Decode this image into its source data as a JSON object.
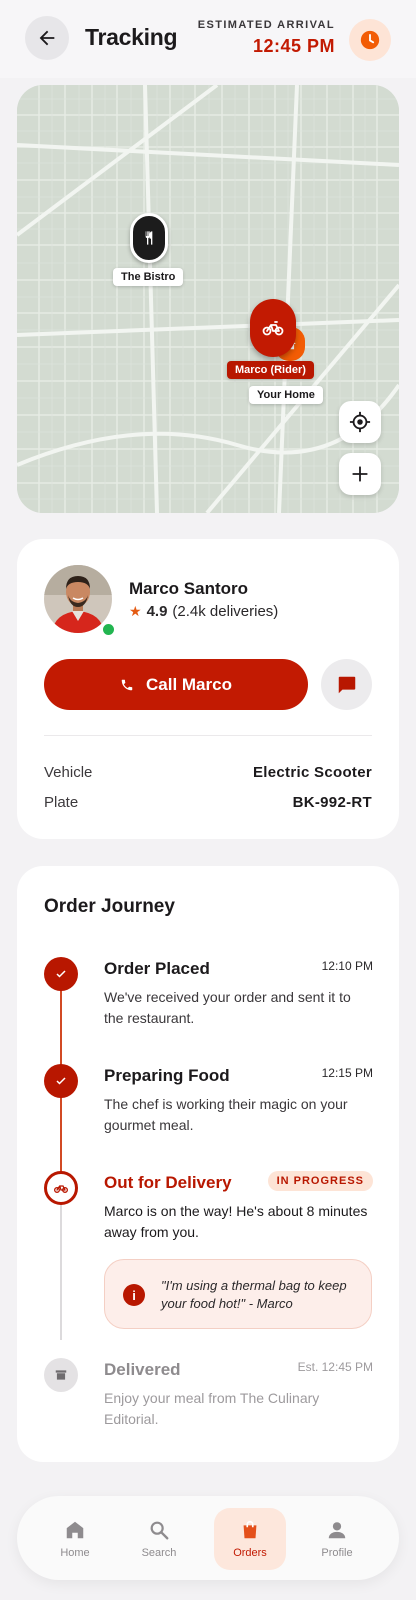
{
  "header": {
    "title": "Tracking",
    "eta_label": "ESTIMATED ARRIVAL",
    "eta_time": "12:45 PM"
  },
  "map": {
    "restaurant_label": "The Bistro",
    "rider_label": "Marco (Rider)",
    "home_label": "Your Home"
  },
  "rider": {
    "name": "Marco Santoro",
    "rating": "4.9",
    "deliveries": "(2.4k deliveries)",
    "call_label": "Call Marco",
    "vehicle_key": "Vehicle",
    "vehicle_value": "Electric Scooter",
    "plate_key": "Plate",
    "plate_value": "BK-992-RT",
    "online": true
  },
  "journey": {
    "title": "Order Journey",
    "steps": [
      {
        "title": "Order Placed",
        "time": "12:10 PM",
        "desc": "We've received your order and sent it to the restaurant.",
        "status": "done"
      },
      {
        "title": "Preparing Food",
        "time": "12:15 PM",
        "desc": "The chef is working their magic on your gourmet meal.",
        "status": "done"
      },
      {
        "title": "Out for Delivery",
        "badge": "IN PROGRESS",
        "desc": "Marco is on the way! He's about 8 minutes away from you.",
        "status": "active"
      },
      {
        "title": "Delivered",
        "time": "Est. 12:45 PM",
        "desc": "Enjoy your meal from The Culinary Editorial.",
        "status": "pending"
      }
    ],
    "note": "\"I'm using a thermal bag to keep your food hot!\" - Marco"
  },
  "nav": {
    "items": [
      {
        "label": "Home",
        "icon": "home-icon"
      },
      {
        "label": "Search",
        "icon": "search-icon"
      },
      {
        "label": "Orders",
        "icon": "shopping-bag-icon",
        "active": true
      },
      {
        "label": "Profile",
        "icon": "person-icon"
      }
    ]
  },
  "colors": {
    "primary": "#c21a02",
    "accent": "#f25c05",
    "background": "#f3f2f4",
    "online": "#22b550"
  }
}
